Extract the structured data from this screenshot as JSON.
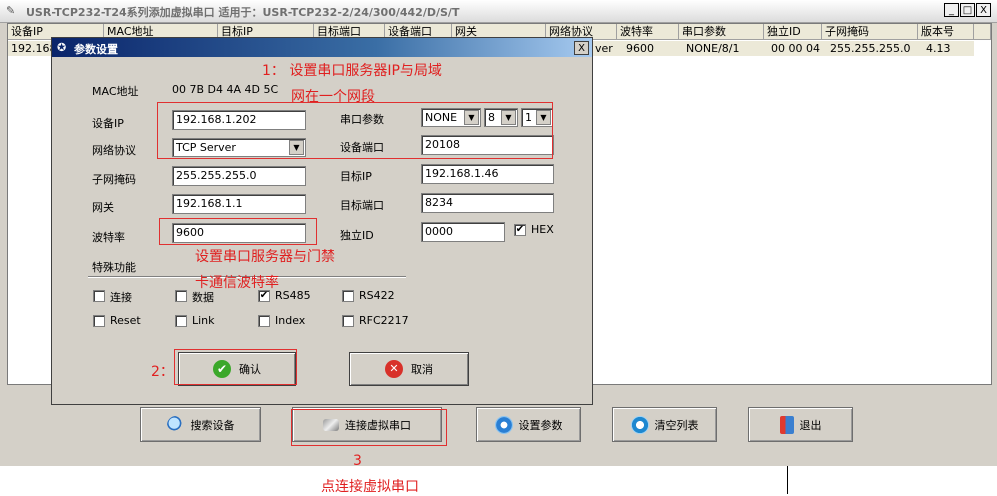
{
  "window": {
    "title": "USR-TCP232-T24系列添加虚拟串口  适用于：USR-TCP232-2/24/300/442/D/S/T",
    "min_label": "_",
    "max_label": "□",
    "close_label": "X"
  },
  "list": {
    "columns": [
      "设备IP",
      "MAC地址",
      "目标IP",
      "目标端口",
      "设备端口",
      "网关",
      "网络协议",
      "波特率",
      "串口参数",
      "独立ID",
      "子网掩码",
      "版本号"
    ],
    "row": {
      "ip": "192.168",
      "protocol": "ver",
      "baud": "9600",
      "serial": "NONE/8/1",
      "id": "00 00 04",
      "mask": "255.255.255.0",
      "version": "4.13"
    }
  },
  "toolbar": {
    "search": "搜索设备",
    "connect": "连接虚拟串口",
    "settings": "设置参数",
    "clear": "清空列表",
    "exit": "退出"
  },
  "dialog": {
    "title": "参数设置",
    "close_label": "X",
    "mac_label": "MAC地址",
    "mac_value": "00 7B D4 4A 4D 5C",
    "ip_label": "设备IP",
    "ip_value": "192.168.1.202",
    "protocol_label": "网络协议",
    "protocol_value": "TCP Server",
    "mask_label": "子网掩码",
    "mask_value": "255.255.255.0",
    "gateway_label": "网关",
    "gateway_value": "192.168.1.1",
    "baud_label": "波特率",
    "baud_value": "9600",
    "serial_label": "串口参数",
    "parity_value": "NONE",
    "databits_value": "8",
    "stopbits_value": "1",
    "port_label": "设备端口",
    "port_value": "20108",
    "target_ip_label": "目标IP",
    "target_ip_value": "192.168.1.46",
    "target_port_label": "目标端口",
    "target_port_value": "8234",
    "id_label": "独立ID",
    "id_value": "0000",
    "hex_label": "HEX",
    "special_label": "特殊功能",
    "checks": {
      "connect": "连接",
      "data": "数据",
      "rs485": "RS485",
      "rs422": "RS422",
      "reset": "Reset",
      "link": "Link",
      "index": "Index",
      "rfc2217": "RFC2217"
    },
    "check_mark": "✔",
    "ok": "确认",
    "cancel": "取消"
  },
  "annotations": {
    "note1_line1": "1：  设置串口服务器IP与局域",
    "note1_line2": "网在一个网段",
    "note_baud_line1": "设置串口服务器与门禁",
    "note_baud_line2": "卡通信波特率",
    "note2": "2：",
    "note3": "3",
    "note3_text": "点连接虚拟串口"
  }
}
